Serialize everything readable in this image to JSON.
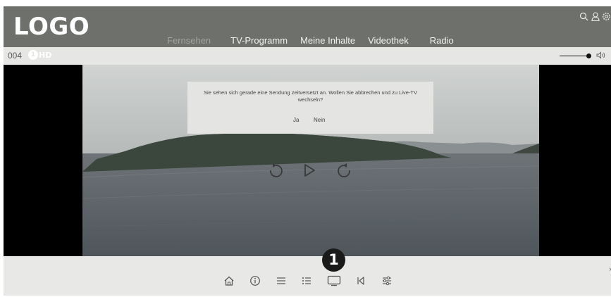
{
  "header": {
    "logo": "LOGO",
    "nav": [
      {
        "label": "Fernsehen",
        "active": true
      },
      {
        "label": "TV-Programm"
      },
      {
        "label": "Meine Inhalte"
      },
      {
        "label": "Videothek"
      },
      {
        "label": "Radio"
      }
    ],
    "icons": [
      "search-icon",
      "user-icon",
      "settings-icon"
    ]
  },
  "channel": {
    "number": "004",
    "logo_badge": "1",
    "logo_hd": "HD",
    "volume": 0.85
  },
  "dialog": {
    "message": "Sie sehen sich gerade eine Sendung zeitversetzt an. Wollen Sie abbrechen und zu Live-TV wechseln?",
    "yes": "Ja",
    "no": "Nein"
  },
  "player_controls": [
    "rewind-icon",
    "play-icon",
    "forward-icon"
  ],
  "bottom_bar": {
    "icons": [
      "home-icon",
      "info-icon",
      "menu-icon",
      "list-icon",
      "tv-icon",
      "skip-back-icon",
      "equalizer-icon"
    ],
    "callout": "1",
    "close": "×"
  },
  "colors": {
    "header_bg": "#6e706b",
    "bar_bg": "#e6e6e4",
    "accent": "#1a1a1a"
  }
}
